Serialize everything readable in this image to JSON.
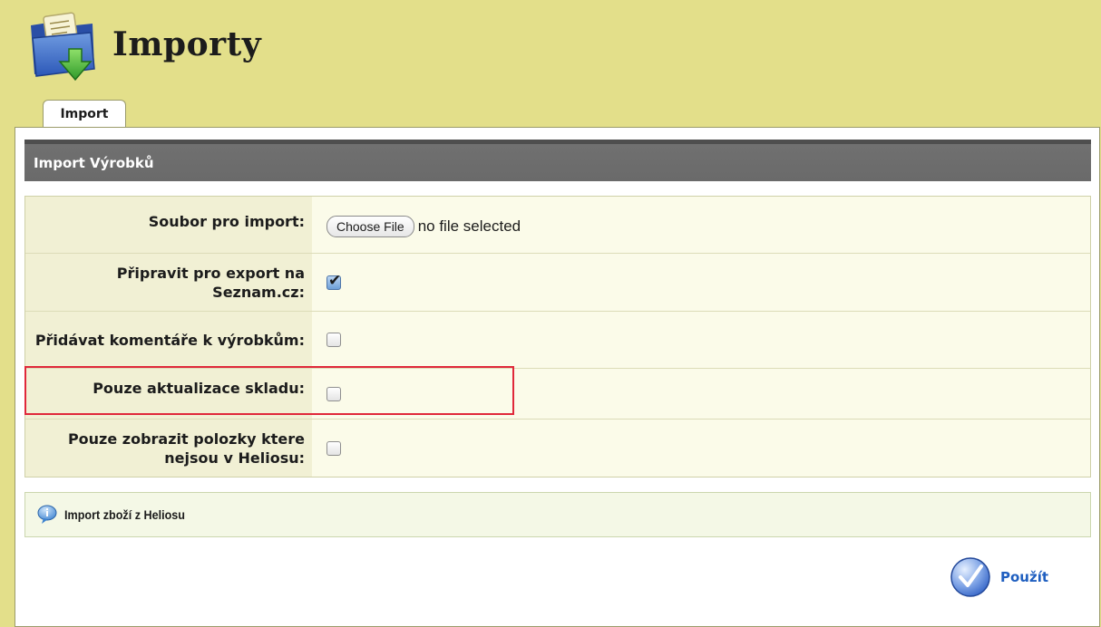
{
  "header": {
    "title": "Importy",
    "logo_icon": "folder-import-icon"
  },
  "tabs": [
    {
      "label": "Import",
      "active": true
    }
  ],
  "section": {
    "title": "Import Výrobků"
  },
  "form": {
    "file_label": "Soubor pro import:",
    "file_button": "Choose File",
    "file_status": "no file selected",
    "rows": [
      {
        "label": "Připravit pro export na Seznam.cz:",
        "checked": true
      },
      {
        "label": "Přidávat komentáře k výrobkům:",
        "checked": false
      },
      {
        "label": "Pouze aktualizace skladu:",
        "checked": false,
        "highlighted": true
      },
      {
        "label": "Pouze zobrazit polozky ktere nejsou v Heliosu:",
        "checked": false
      }
    ]
  },
  "info": {
    "text": "Import zboží z Heliosu",
    "icon": "info-bubble-icon"
  },
  "actions": {
    "apply_label": "Použít",
    "apply_icon": "checkmark-circle-icon"
  },
  "colors": {
    "background": "#e3df8a",
    "section_bar": "#6e6e6e",
    "highlight": "#e0283a",
    "link": "#1f5fc0"
  }
}
